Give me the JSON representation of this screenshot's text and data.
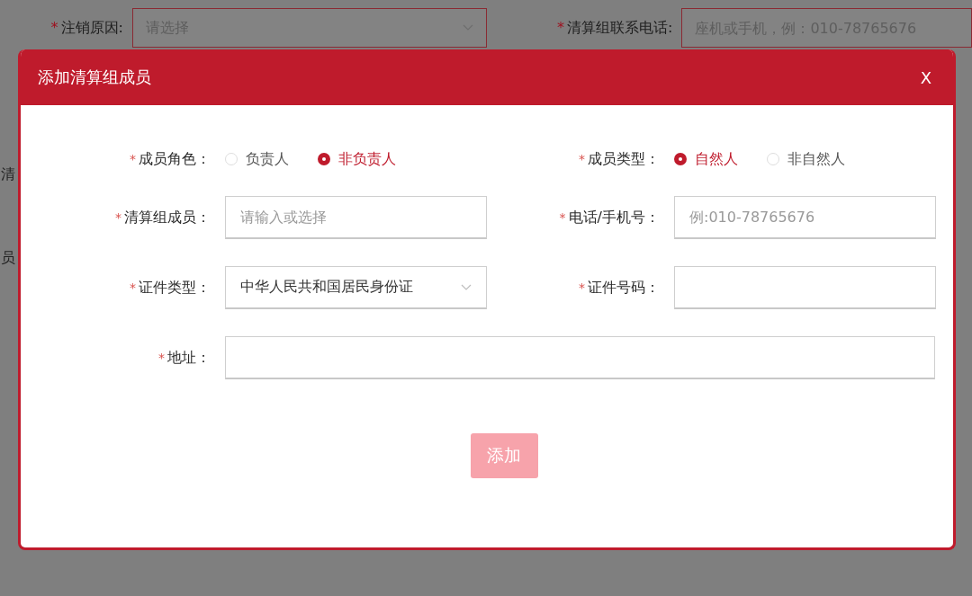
{
  "background_form": {
    "fields": [
      {
        "required_mark": "*",
        "label": "注销原因:",
        "kind": "select",
        "placeholder": "请选择"
      },
      {
        "required_mark": "*",
        "label": "清算组联系电话:",
        "kind": "input",
        "placeholder": "座机或手机，例：010-78765676"
      }
    ],
    "fragments": [
      "清",
      "员"
    ]
  },
  "dialog": {
    "title": "添加清算组成员",
    "close": "X",
    "rows": [
      {
        "items": [
          {
            "kind": "radio",
            "required_mark": "*",
            "label": "成员角色：",
            "options": [
              {
                "label": "负责人",
                "selected": false
              },
              {
                "label": "非负责人",
                "selected": true
              }
            ]
          },
          {
            "kind": "radio",
            "required_mark": "*",
            "label": "成员类型：",
            "options": [
              {
                "label": "自然人",
                "selected": true
              },
              {
                "label": "非自然人",
                "selected": false
              }
            ]
          }
        ]
      },
      {
        "items": [
          {
            "kind": "input",
            "required_mark": "*",
            "label": "清算组成员：",
            "placeholder": "请输入或选择"
          },
          {
            "kind": "input",
            "required_mark": "*",
            "label": "电话/手机号：",
            "placeholder": "例:010-78765676"
          }
        ]
      },
      {
        "items": [
          {
            "kind": "select",
            "required_mark": "*",
            "label": "证件类型：",
            "value": "中华人民共和国居民身份证"
          },
          {
            "kind": "input",
            "required_mark": "*",
            "label": "证件号码："
          }
        ]
      },
      {
        "items": [
          {
            "kind": "input",
            "required_mark": "*",
            "label": "地址："
          }
        ]
      }
    ],
    "submit": {
      "label": "添加",
      "disabled": true
    }
  }
}
